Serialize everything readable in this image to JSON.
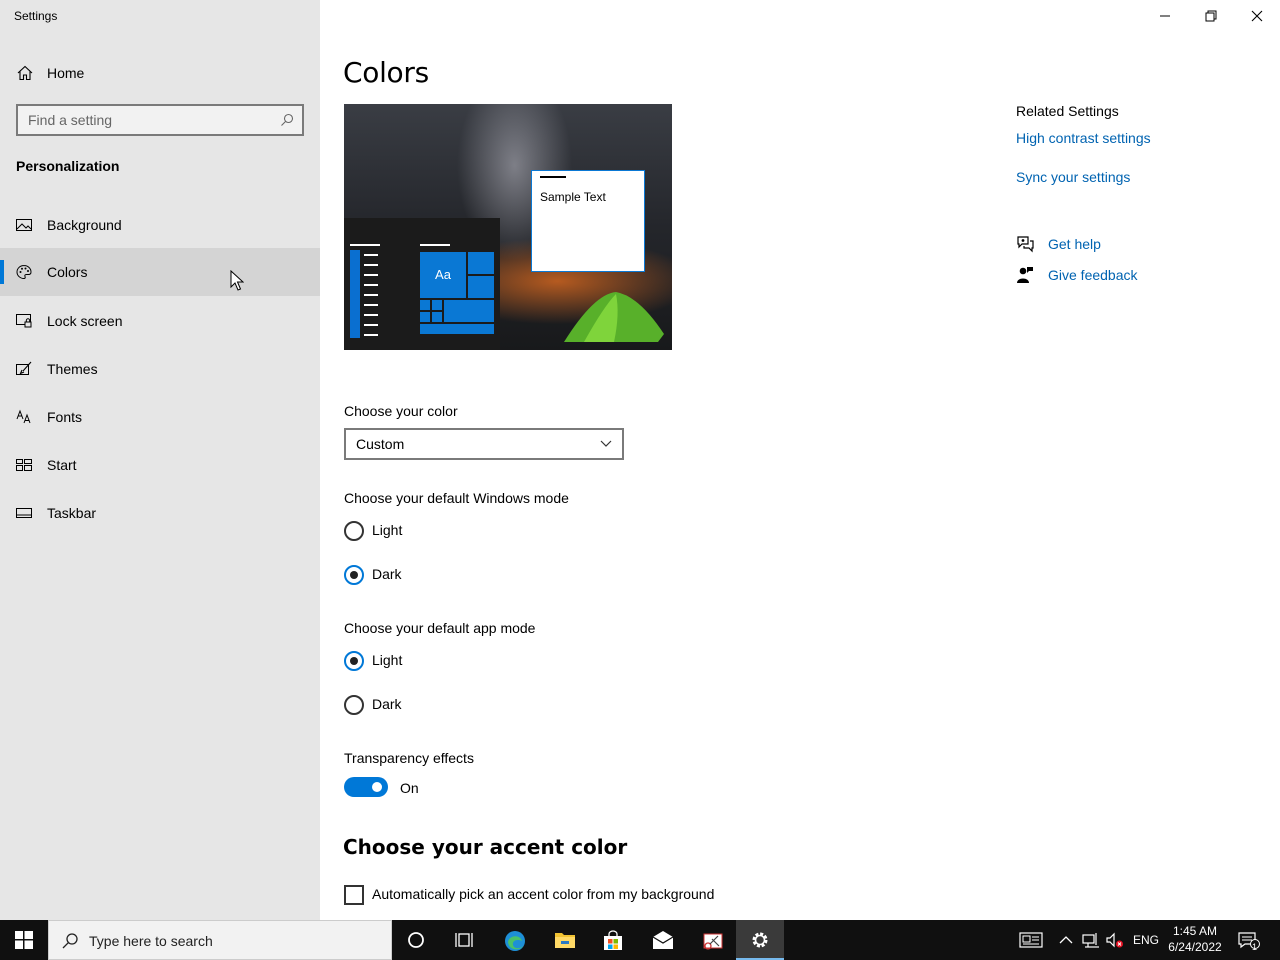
{
  "window": {
    "title": "Settings",
    "controls": {
      "minimize": "minimize",
      "maximize": "restore",
      "close": "close"
    }
  },
  "sidebar": {
    "home_label": "Home",
    "search_placeholder": "Find a setting",
    "section_title": "Personalization",
    "items": [
      {
        "label": "Background",
        "icon": "picture-icon",
        "active": false
      },
      {
        "label": "Colors",
        "icon": "palette-icon",
        "active": true
      },
      {
        "label": "Lock screen",
        "icon": "lock-screen-icon",
        "active": false
      },
      {
        "label": "Themes",
        "icon": "brush-icon",
        "active": false
      },
      {
        "label": "Fonts",
        "icon": "font-icon",
        "active": false
      },
      {
        "label": "Start",
        "icon": "start-icon",
        "active": false
      },
      {
        "label": "Taskbar",
        "icon": "taskbar-icon",
        "active": false
      }
    ]
  },
  "main": {
    "title": "Colors",
    "preview": {
      "tile_label": "Aa",
      "sample_text": "Sample Text"
    },
    "choose_color": {
      "label": "Choose your color",
      "value": "Custom"
    },
    "windows_mode": {
      "label": "Choose your default Windows mode",
      "options": [
        {
          "label": "Light",
          "checked": false
        },
        {
          "label": "Dark",
          "checked": true
        }
      ]
    },
    "app_mode": {
      "label": "Choose your default app mode",
      "options": [
        {
          "label": "Light",
          "checked": true
        },
        {
          "label": "Dark",
          "checked": false
        }
      ]
    },
    "transparency": {
      "label": "Transparency effects",
      "state": "On",
      "on": true
    },
    "accent": {
      "heading": "Choose your accent color",
      "auto_pick_label": "Automatically pick an accent color from my background",
      "auto_pick_checked": false
    }
  },
  "related": {
    "title": "Related Settings",
    "links": [
      "High contrast settings",
      "Sync your settings"
    ],
    "get_help": "Get help",
    "give_feedback": "Give feedback"
  },
  "taskbar": {
    "search_placeholder": "Type here to search",
    "language": "ENG",
    "time": "1:45 AM",
    "date": "6/24/2022",
    "notification_count": "1"
  },
  "colors": {
    "accent": "#0078d7",
    "link": "#0063b1",
    "sidebar_bg": "#e6e6e6",
    "taskbar_bg": "#101010"
  }
}
